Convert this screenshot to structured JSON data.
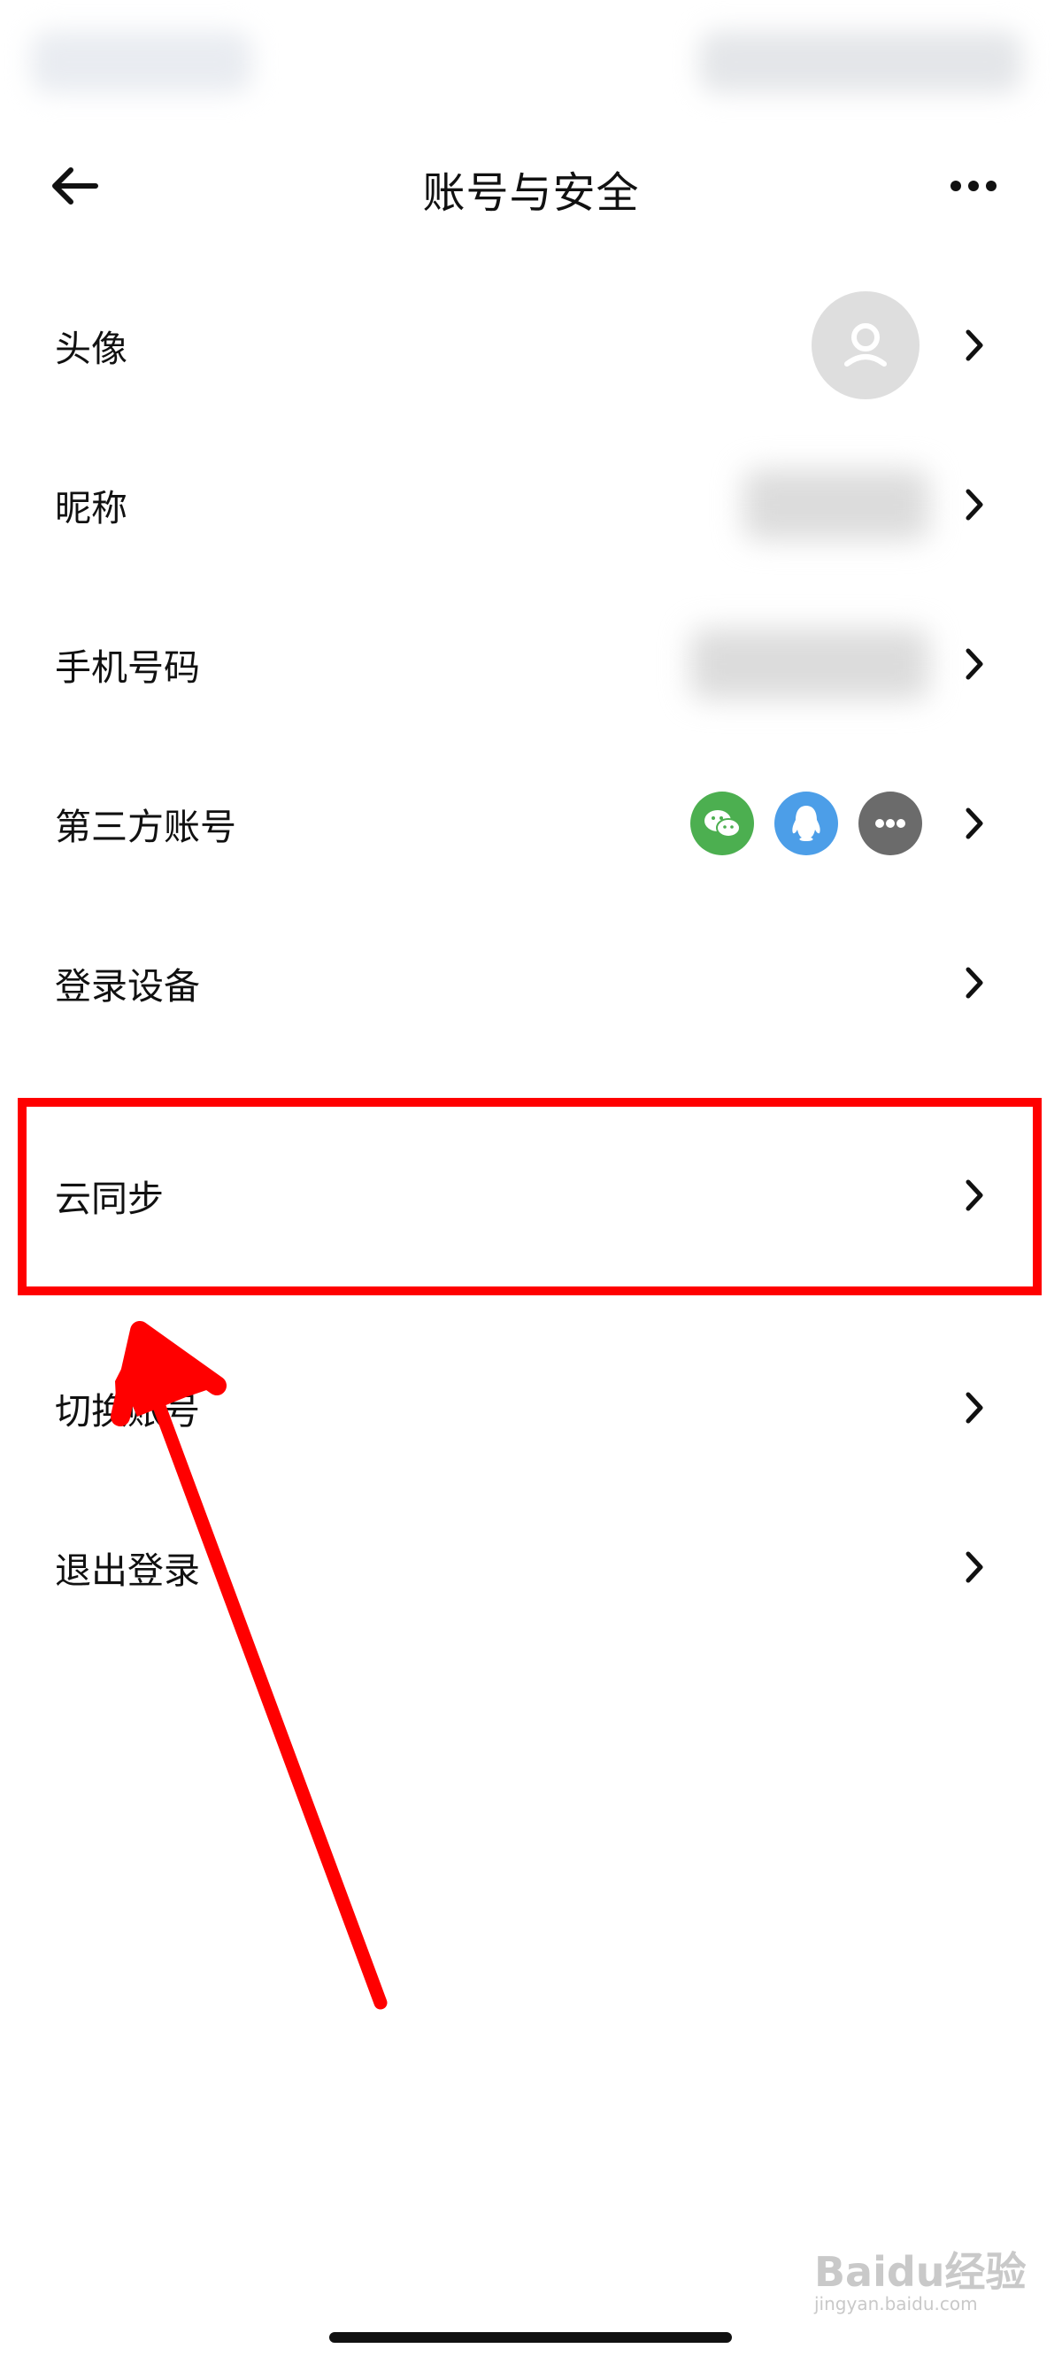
{
  "header": {
    "title": "账号与安全"
  },
  "rows": [
    {
      "label": "头像"
    },
    {
      "label": "昵称"
    },
    {
      "label": "手机号码"
    },
    {
      "label": "第三方账号"
    },
    {
      "label": "登录设备"
    },
    {
      "label": "云同步"
    },
    {
      "label": "切换账号"
    },
    {
      "label": "退出登录"
    }
  ],
  "third_party_accounts": [
    {
      "icon": "wechat-icon",
      "color": "#4caf50"
    },
    {
      "icon": "qq-icon",
      "color": "#4c9ee8"
    },
    {
      "icon": "more-accounts-icon",
      "color": "#6b6b6b"
    }
  ],
  "highlight": {
    "target": "云同步",
    "color": "#ff0000"
  },
  "watermark": {
    "logo": "Baidu经验",
    "sub": "jingyan.baidu.com"
  }
}
